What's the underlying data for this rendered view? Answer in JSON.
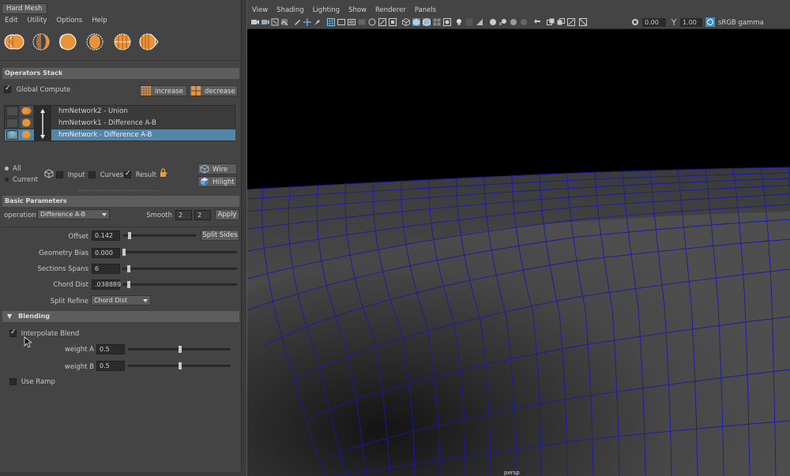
{
  "window_tab": "Hard Mesh",
  "menu": [
    "Edit",
    "Utility",
    "Options",
    "Help"
  ],
  "shelf_icons": [
    "hardmesh-union-icon",
    "hardmesh-difference-icon",
    "hardmesh-difference-ba-icon",
    "hardmesh-intersection-icon",
    "hardmesh-split-icon",
    "hardmesh-slice-icon"
  ],
  "operators_stack": {
    "title": "Operators Stack",
    "global_compute": "Global Compute",
    "increase": "increase",
    "decrease": "decrease",
    "items": [
      {
        "label": "hmNetwork2 - Union",
        "selected": false
      },
      {
        "label": "hmNetwork1 - Difference A-B",
        "selected": false
      },
      {
        "label": "hmNetwork - Difference A-B",
        "selected": true
      }
    ],
    "radio_all": "All",
    "radio_current": "Current",
    "input": "Input",
    "curves": "Curves",
    "result": "Result",
    "wire": "Wire",
    "hilight": "Hilight"
  },
  "basic_parameters": {
    "title": "Basic Parameters",
    "operation_label": "operation",
    "operation_value": "Difference A-B",
    "smooth_label": "Smooth",
    "smooth_a": "2",
    "smooth_b": "2",
    "apply": "Apply",
    "offset_label": "Offset",
    "offset_value": "0.142",
    "split_sides": "Split Sides",
    "geometry_bias_label": "Geometry Bias",
    "geometry_bias_value": "0.000",
    "sections_spans_label": "Sections Spans",
    "sections_spans_value": "6",
    "chord_dist_label": "Chord Dist",
    "chord_dist_value": ".038889",
    "split_refine_label": "Split Refine",
    "split_refine_value": "Chord Dist"
  },
  "blending": {
    "title": "Blending",
    "interpolate_blend": "Interpolate Blend",
    "weight_a_label": "weight A",
    "weight_a_value": "0.5",
    "weight_b_label": "weight B",
    "weight_b_value": "0.5",
    "use_ramp": "Use Ramp"
  },
  "viewport": {
    "menu": [
      "View",
      "Shading",
      "Lighting",
      "Show",
      "Renderer",
      "Panels"
    ],
    "exposure": "0.00",
    "gamma": "1.00",
    "color_space": "sRGB gamma",
    "camera": "persp"
  },
  "colors": {
    "accent_select": "#5285a6",
    "panel_bg": "#444444",
    "wire_color": "#1a1aa8"
  }
}
